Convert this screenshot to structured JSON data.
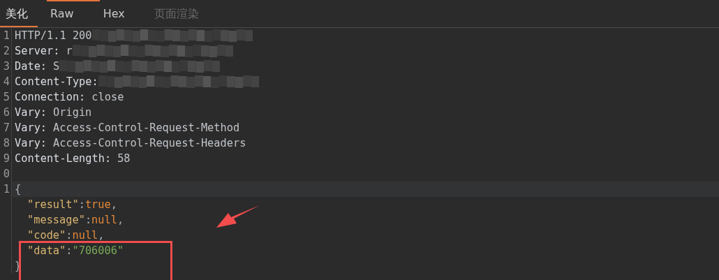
{
  "tabs": [
    {
      "label": "美化",
      "selected": true,
      "disabled": false
    },
    {
      "label": "Raw",
      "selected": false,
      "disabled": false
    },
    {
      "label": "Hex",
      "selected": false,
      "disabled": false
    },
    {
      "label": "页面渲染",
      "selected": false,
      "disabled": true
    }
  ],
  "lines": [
    {
      "number": "1",
      "kind": "text",
      "text": "HTTP/1.1 200",
      "redacted": true
    },
    {
      "number": "2",
      "kind": "header",
      "key": "Server:",
      "value": "r",
      "redacted": true
    },
    {
      "number": "3",
      "kind": "header",
      "key": "Date:",
      "value": "S",
      "redacted": true
    },
    {
      "number": "4",
      "kind": "header",
      "key": "Content-Type:",
      "redacted": true
    },
    {
      "number": "5",
      "kind": "header",
      "key": "Connection:",
      "value": "close"
    },
    {
      "number": "6",
      "kind": "header",
      "key": "Vary:",
      "value": "Origin"
    },
    {
      "number": "7",
      "kind": "header",
      "key": "Vary:",
      "value": "Access-Control-Request-Method"
    },
    {
      "number": "8",
      "kind": "header",
      "key": "Vary:",
      "value": "Access-Control-Request-Headers"
    },
    {
      "number": "9",
      "kind": "header",
      "key": "Content-Length:",
      "value": "58"
    },
    {
      "number": "0",
      "kind": "blank"
    },
    {
      "number": "1",
      "kind": "json",
      "current": true,
      "tokens": [
        {
          "kind": "punct",
          "text": "{"
        }
      ]
    },
    {
      "kind": "json",
      "tokens": [
        {
          "kind": "key",
          "text": "\"result\""
        },
        {
          "kind": "punct",
          "text": ":"
        },
        {
          "kind": "literal",
          "text": "true"
        },
        {
          "kind": "punct",
          "text": ","
        }
      ]
    },
    {
      "kind": "json",
      "tokens": [
        {
          "kind": "key",
          "text": "\"message\""
        },
        {
          "kind": "punct",
          "text": ":"
        },
        {
          "kind": "literal",
          "text": "null"
        },
        {
          "kind": "punct",
          "text": ","
        }
      ]
    },
    {
      "kind": "json",
      "tokens": [
        {
          "kind": "key",
          "text": "\"code\""
        },
        {
          "kind": "punct",
          "text": ":"
        },
        {
          "kind": "literal",
          "text": "null"
        },
        {
          "kind": "punct",
          "text": ","
        }
      ]
    },
    {
      "kind": "json",
      "tokens": [
        {
          "kind": "key",
          "text": "\"data\""
        },
        {
          "kind": "punct",
          "text": ":"
        },
        {
          "kind": "string",
          "text": "\"706006\""
        }
      ]
    },
    {
      "kind": "json",
      "tokens": [
        {
          "kind": "punct",
          "text": "}"
        }
      ]
    }
  ],
  "annotations": {
    "arrow": true,
    "box": true
  }
}
